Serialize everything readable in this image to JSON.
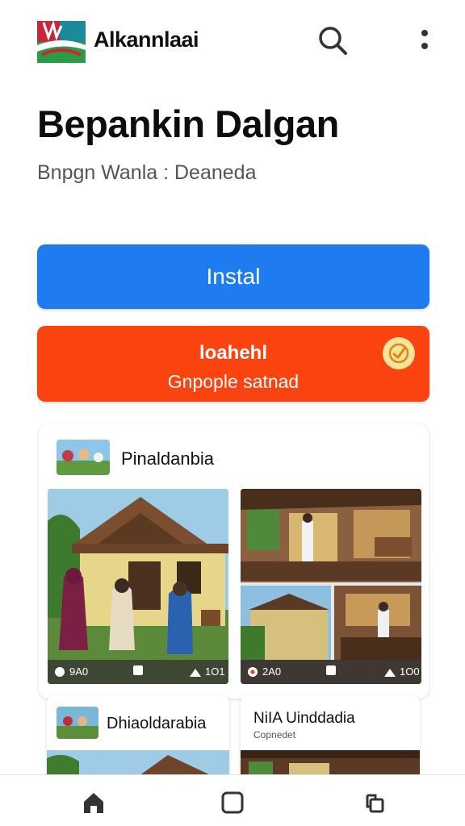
{
  "header": {
    "app_name": "Alkannlaai",
    "search_icon": "search-icon",
    "more_icon": "more-vert-icon"
  },
  "title": "Bepankin Dalgan",
  "subtitle": "Bnpgn Wanla : Deaneda",
  "buttons": {
    "install_label": "Instal",
    "orange_title": "loahehl",
    "orange_subtitle": "Gnpople satnad",
    "orange_icon": "clock-icon"
  },
  "colors": {
    "install": "#1f7cf0",
    "orange": "#fb4310"
  },
  "card": {
    "title": "Pinaldanbia",
    "photos": [
      {
        "views": "9A0",
        "likes": "1O1"
      },
      {
        "views": "2A0",
        "likes": "1O0"
      }
    ]
  },
  "cards_bottom": [
    {
      "title": "Dhiaoldarabia"
    },
    {
      "title": "NiIA Uinddadia",
      "subtitle": "Copnedet"
    }
  ],
  "bottom_nav": [
    "home-icon",
    "square-icon",
    "recents-icon"
  ]
}
